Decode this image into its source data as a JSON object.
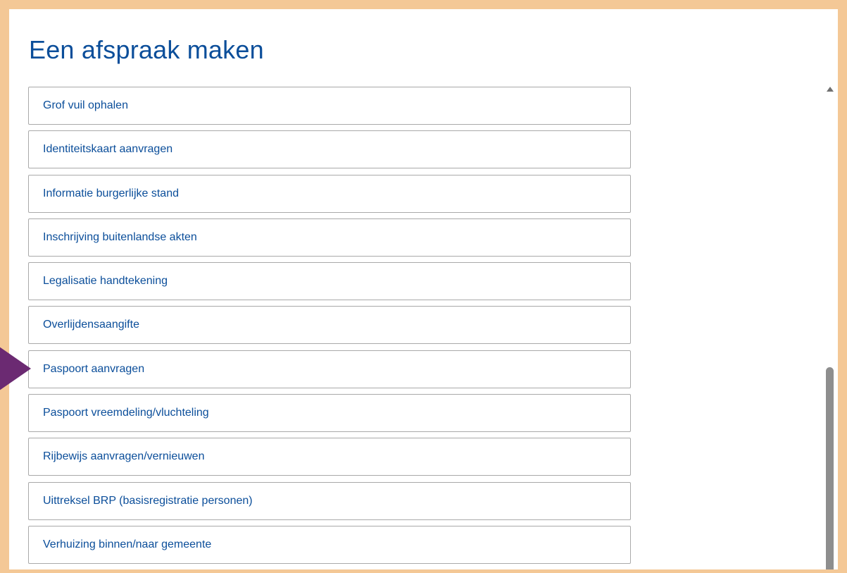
{
  "page": {
    "title": "Een afspraak maken"
  },
  "options": [
    {
      "label": "Grof vuil ophalen"
    },
    {
      "label": "Identiteitskaart aanvragen"
    },
    {
      "label": "Informatie burgerlijke stand"
    },
    {
      "label": "Inschrijving buitenlandse akten"
    },
    {
      "label": "Legalisatie handtekening"
    },
    {
      "label": "Overlijdensaangifte"
    },
    {
      "label": "Paspoort aanvragen"
    },
    {
      "label": "Paspoort vreemdeling/vluchteling"
    },
    {
      "label": "Rijbewijs aanvragen/vernieuwen"
    },
    {
      "label": "Uittreksel BRP (basisregistratie personen)"
    },
    {
      "label": "Verhuizing binnen/naar gemeente"
    }
  ],
  "highlight": {
    "target_option": "Paspoort aanvragen",
    "pointer_icon": "pointer-arrow-icon",
    "color": "#6b2a72"
  },
  "colors": {
    "frame": "#f4c896",
    "title": "#0b4e9a",
    "option_text": "#0b4e9a",
    "option_border": "#a9a9a9",
    "scrollbar_thumb": "#8e8e8e"
  }
}
